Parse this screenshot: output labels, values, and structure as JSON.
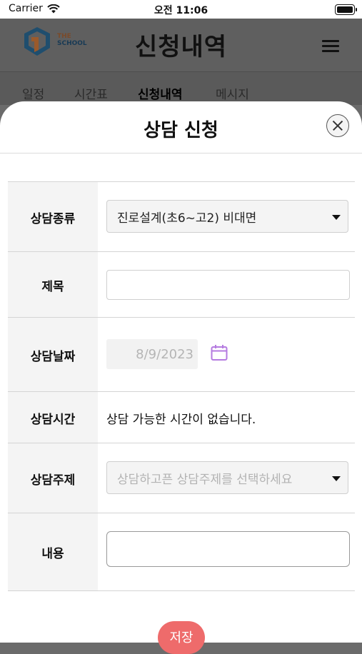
{
  "status_bar": {
    "carrier": "Carrier",
    "time": "오전 11:06",
    "icons": [
      "wifi-icon",
      "battery-icon"
    ]
  },
  "app_header": {
    "logo_line1": "THE",
    "logo_line2": "SCHOOL",
    "title": "신청내역",
    "menu_icon": "hamburger-menu-icon"
  },
  "tabs": [
    {
      "label": "일정",
      "active": false
    },
    {
      "label": "시간표",
      "active": false
    },
    {
      "label": "신청내역",
      "active": true
    },
    {
      "label": "메시지",
      "active": false
    }
  ],
  "modal": {
    "title": "상담 신청",
    "close_icon": "close-icon",
    "fields": {
      "type": {
        "label": "상담종류",
        "value": "진로설계(초6~고2) 비대면"
      },
      "subject": {
        "label": "제목",
        "value": ""
      },
      "date": {
        "label": "상담날짜",
        "value": "8/9/2023"
      },
      "time": {
        "label": "상담시간",
        "value": "상담 가능한 시간이 없습니다."
      },
      "topic": {
        "label": "상담주제",
        "placeholder": "상담하고픈 상담주제를 선택하세요"
      },
      "content": {
        "label": "내용",
        "value": ""
      }
    },
    "save_label": "저장"
  },
  "colors": {
    "overlay": "#6b6b6b",
    "save_button": "#ee6b6b",
    "calendar_icon": "#b57be0",
    "label_bg": "#f4f4f4"
  }
}
